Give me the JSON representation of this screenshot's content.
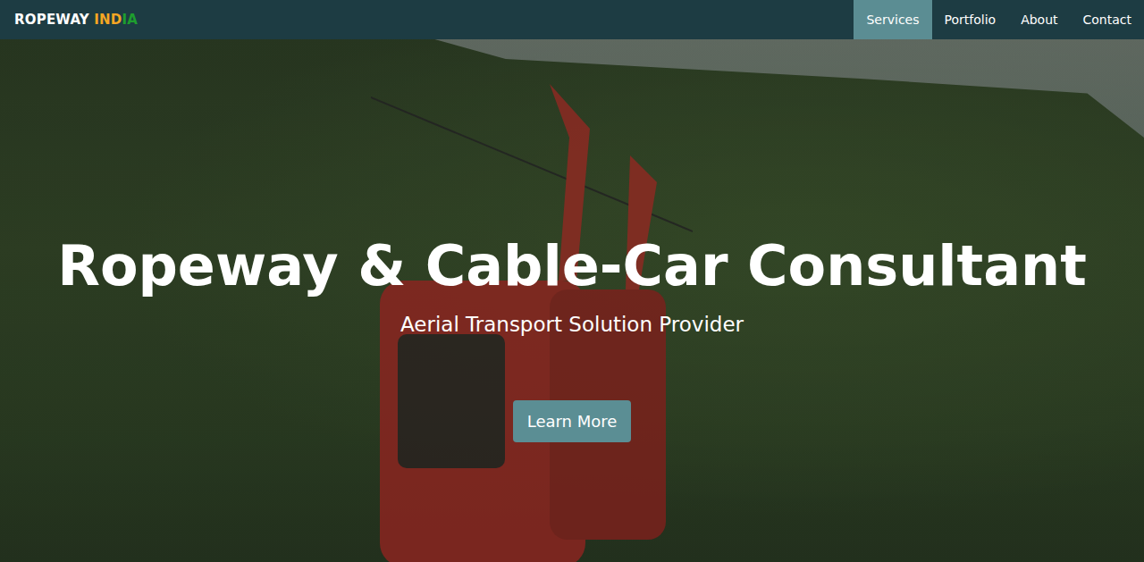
{
  "brand": [
    {
      "text": "ROPEWAY ",
      "color": "#ffffff"
    },
    {
      "text": "IND",
      "color": "#f5a623"
    },
    {
      "text": "IA",
      "color": "#1e9e2e"
    }
  ],
  "nav": [
    {
      "label": "Services",
      "selected": true
    },
    {
      "label": "Portfolio",
      "selected": false
    },
    {
      "label": "About",
      "selected": false
    },
    {
      "label": "Contact",
      "selected": false
    }
  ],
  "hero": {
    "title": "Ropeway & Cable-Car Consultant",
    "subtitle": "Aerial Transport Solution Provider",
    "button": "Learn More"
  }
}
